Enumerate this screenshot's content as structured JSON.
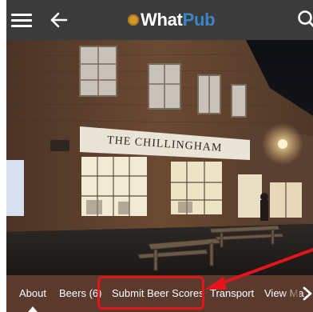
{
  "app": {
    "logo_text_what": "What",
    "logo_text_pub": "Pub"
  },
  "photo": {
    "pub_sign_text": "THE CHILLINGHAM"
  },
  "tabs": [
    {
      "label": "About",
      "active": true
    },
    {
      "label": "Beers (6)",
      "active": false
    },
    {
      "label": "Submit Beer Scores",
      "active": false
    },
    {
      "label": "Transport",
      "active": false
    },
    {
      "label": "View Ma",
      "active": false
    }
  ],
  "icons": [
    "menu-icon",
    "back-arrow-icon",
    "search-icon",
    "chevron-right-icon"
  ],
  "colors": {
    "appbar": "#3b3b3b",
    "tabbar": "#5a3a2c",
    "logo_pub": "#3a86c8",
    "annotation": "#e3141b"
  }
}
